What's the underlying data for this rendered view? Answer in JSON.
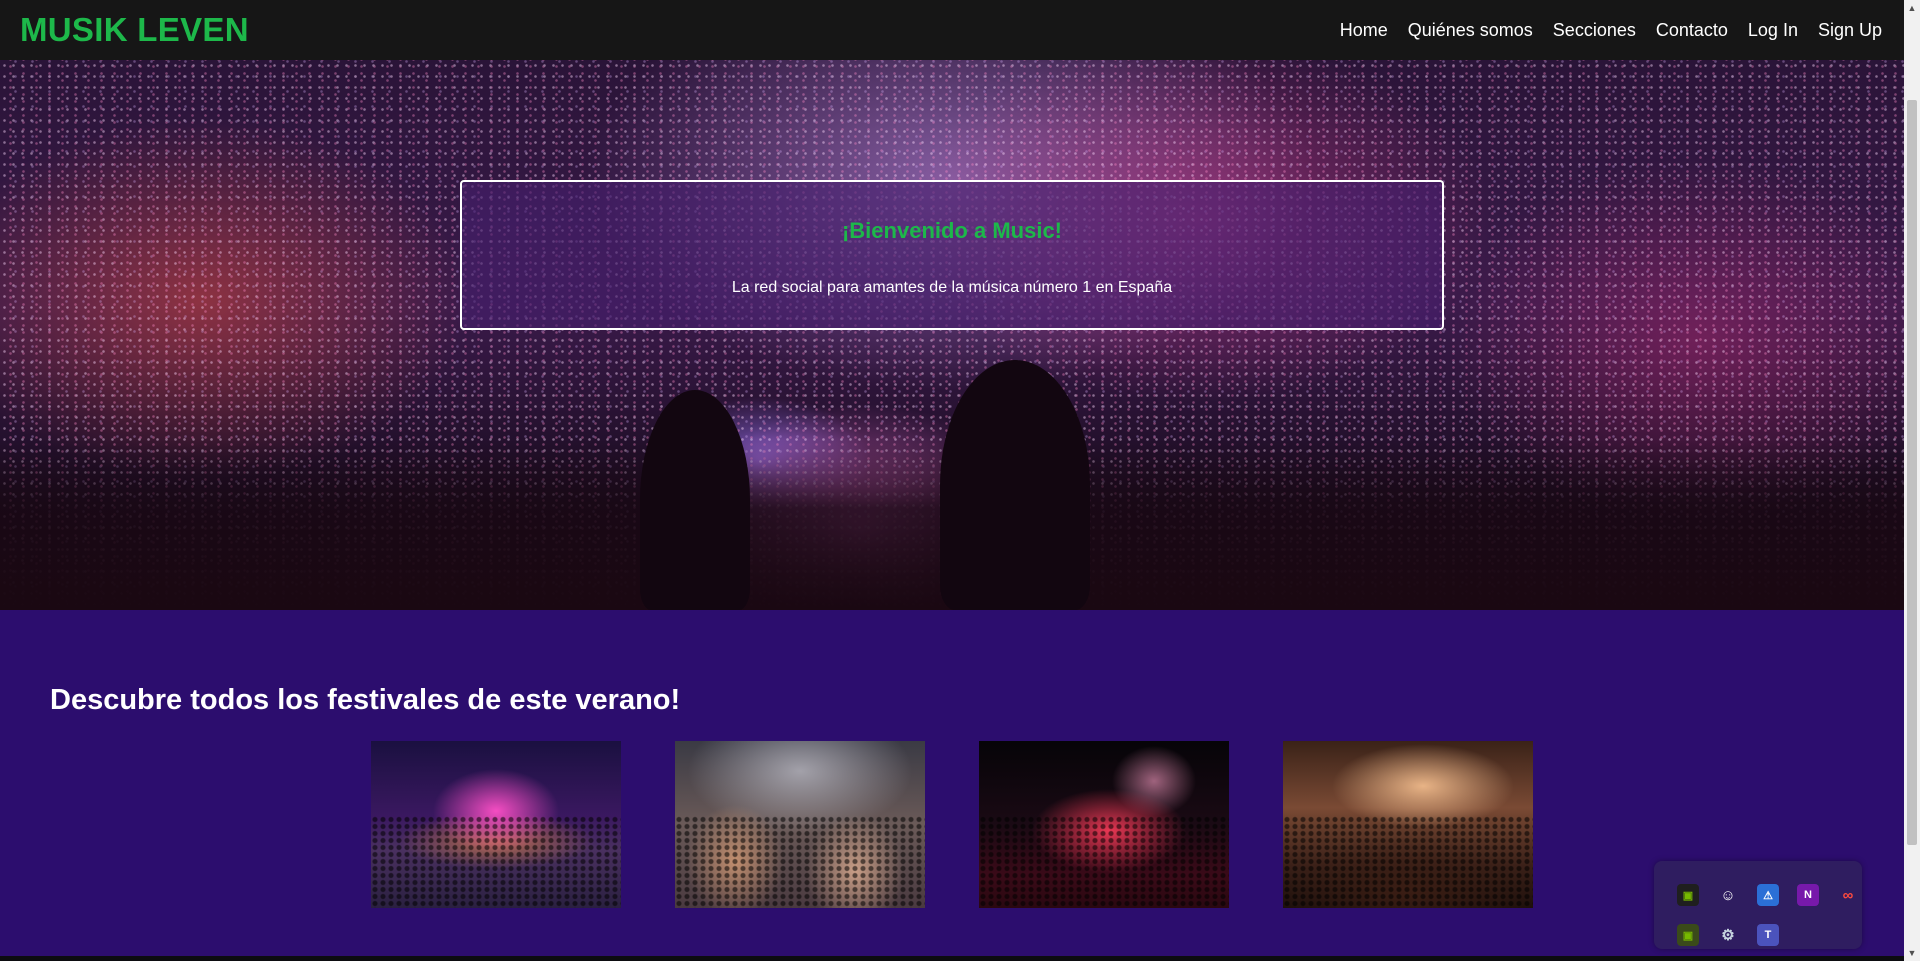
{
  "navbar": {
    "brand": "MUSIK LEVEN",
    "links": [
      "Home",
      "Quiénes somos",
      "Secciones",
      "Contacto",
      "Log In",
      "Sign Up"
    ]
  },
  "hero": {
    "title": "¡Bienvenido a Music!",
    "subtitle": "La red social para amantes de la música número 1 en España"
  },
  "festivals": {
    "heading": "Descubre todos los festivales de este verano!",
    "images": [
      "festival-stage-fireworks",
      "festival-crowd-closeup",
      "festival-stage-night-fireworks",
      "concert-crowd-stage-lights"
    ]
  },
  "tray_icons": [
    "nvidia-icon",
    "discord-icon",
    "security-warning-icon",
    "onenote-icon",
    "creative-cloud-icon",
    "nvidia-broadcast-icon",
    "steam-icon",
    "teams-icon"
  ],
  "colors": {
    "brand_green": "#1db84a",
    "navbar_bg": "#161616",
    "section_bg": "#2c0d6e"
  }
}
